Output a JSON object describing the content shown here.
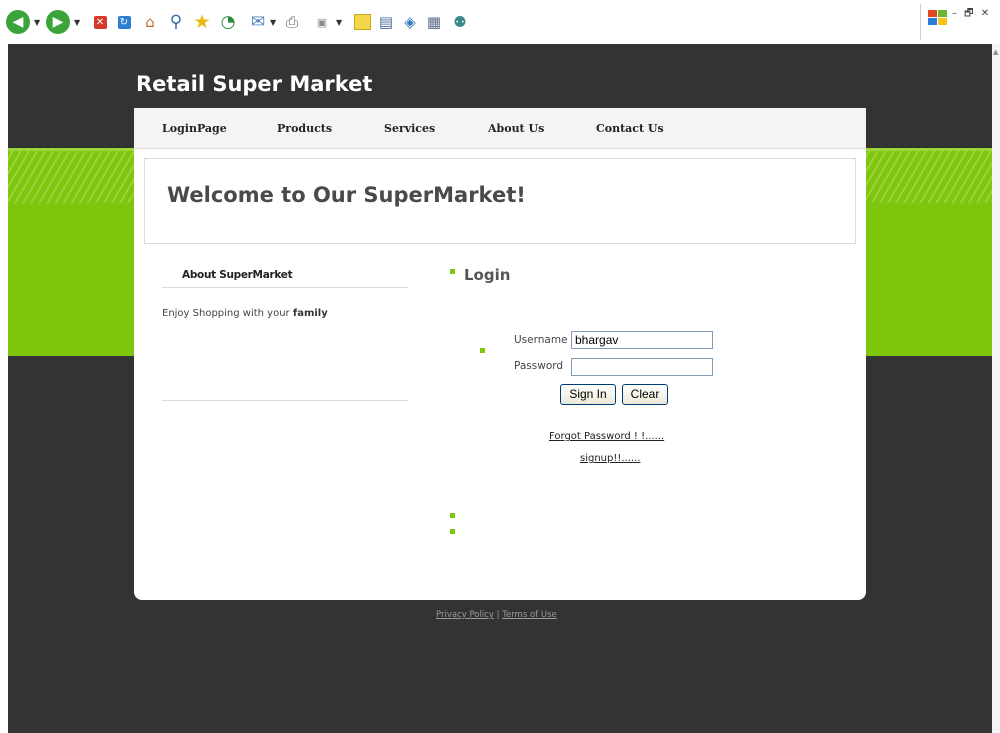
{
  "browser": {
    "toolbar_icons": [
      "back-icon",
      "forward-icon",
      "stop-icon",
      "refresh-icon",
      "home-icon",
      "search-icon",
      "favorites-star-icon",
      "history-icon",
      "mail-icon",
      "print-icon",
      "edit-icon",
      "discuss-icon",
      "messenger-icon",
      "research-icon",
      "media-icon",
      "users-icon"
    ],
    "window_controls": "– 🗗 ✕"
  },
  "site": {
    "title": "Retail Super Market",
    "nav": [
      "LoginPage",
      "Products",
      "Services",
      "About Us",
      "Contact Us"
    ],
    "welcome": "Welcome to Our SuperMarket!"
  },
  "sidebar": {
    "title": "About SuperMarket",
    "text_prefix": "Enjoy Shopping with your ",
    "text_bold": "family"
  },
  "login": {
    "title": "Login",
    "username_label": "Username",
    "username_value": "bhargav",
    "password_label": "Password",
    "password_value": "",
    "sign_in": "Sign In",
    "clear": "Clear",
    "forgot": "Forgot Password ! !......",
    "signup": "signup!!......"
  },
  "footer": {
    "privacy": "Privacy Policy",
    "separator": "|",
    "terms": "Terms of Use"
  },
  "colors": {
    "page_dark": "#333333",
    "accent_green": "#7ec50e",
    "card": "#ffffff"
  }
}
